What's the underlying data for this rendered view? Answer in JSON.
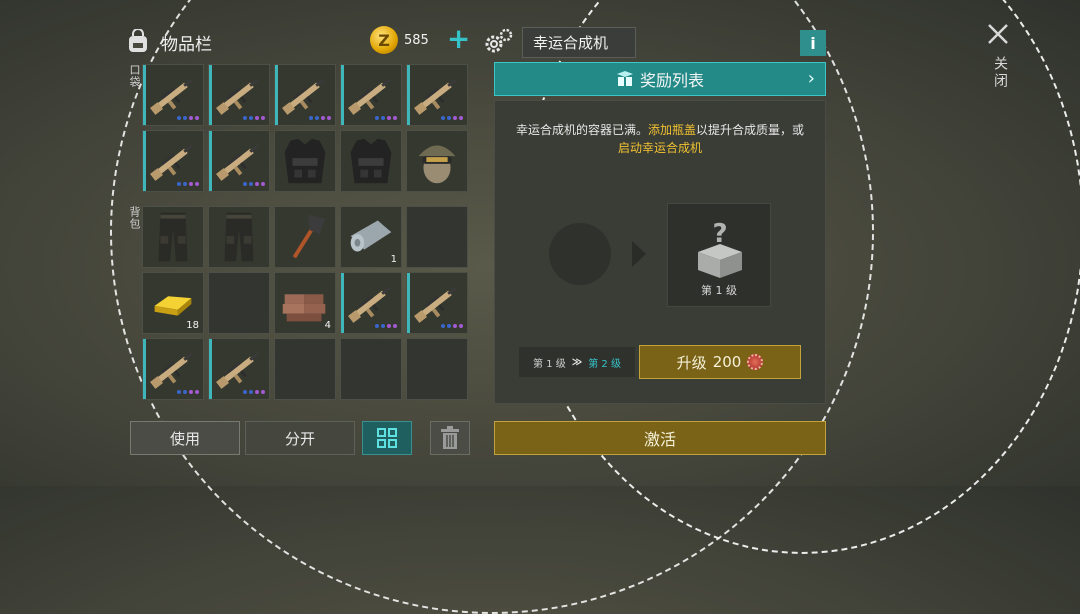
{
  "inventory": {
    "title": "物品栏",
    "pocket_label": "口袋",
    "backpack_label": "背包",
    "coins": "585",
    "pocket": [
      {
        "item": "assault-rifle",
        "dots": true
      },
      {
        "item": "assault-rifle",
        "dots": true
      },
      {
        "item": "assault-rifle",
        "dots": true
      },
      {
        "item": "assault-rifle",
        "dots": true
      },
      {
        "item": "assault-rifle",
        "dots": true
      },
      {
        "item": "assault-rifle",
        "dots": true
      },
      {
        "item": "assault-rifle",
        "dots": true
      },
      {
        "item": "tactical-vest"
      },
      {
        "item": "tactical-vest"
      },
      {
        "item": "tactical-helmet"
      }
    ],
    "backpack": [
      {
        "item": "tactical-pants"
      },
      {
        "item": "tactical-pants"
      },
      {
        "item": "shovel"
      },
      {
        "item": "metal-sheet",
        "qty": "1"
      },
      {
        "item": ""
      },
      {
        "item": "gold-bar",
        "qty": "18"
      },
      {
        "item": ""
      },
      {
        "item": "bricks",
        "qty": "4"
      },
      {
        "item": "assault-rifle",
        "dots": true
      },
      {
        "item": "assault-rifle",
        "dots": true
      },
      {
        "item": "assault-rifle",
        "dots": true
      },
      {
        "item": "assault-rifle",
        "dots": true
      },
      {
        "item": ""
      },
      {
        "item": ""
      },
      {
        "item": ""
      }
    ],
    "buttons": {
      "use": "使用",
      "split": "分开"
    }
  },
  "crafter": {
    "name": "幸运合成机",
    "info": "i",
    "rewards_label": "奖励列表",
    "message_part1": "幸运合成机的容器已满。",
    "message_part2": "添加瓶盖",
    "message_part3": "以提升合成质量，或",
    "message_part4": "启动幸运合成机",
    "output_level": "第 1 级",
    "current_level": "第 1 级",
    "next_level": "第 2 级",
    "level_arrow": "≫",
    "upgrade_label": "升级",
    "upgrade_cost": "200",
    "activate_label": "激活"
  },
  "close": {
    "label": "关闭"
  },
  "colors": {
    "accent": "#238a88",
    "gold": "#7a6316",
    "highlight": "#f1c232"
  }
}
